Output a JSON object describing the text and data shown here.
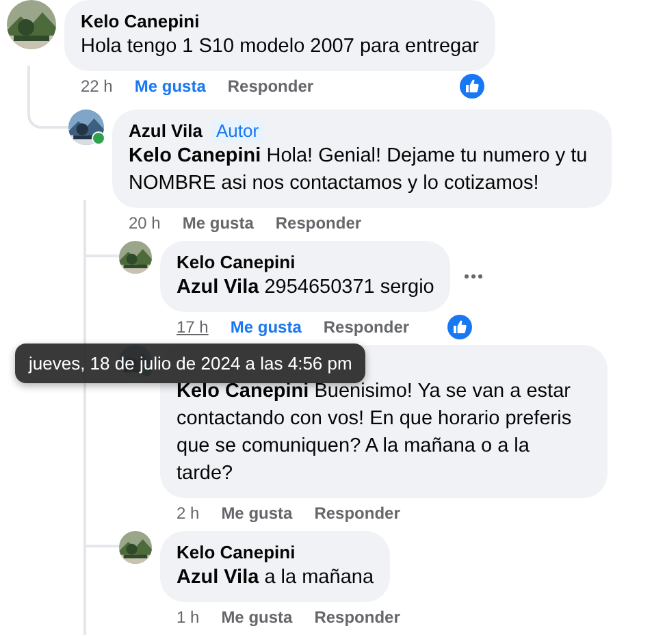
{
  "comments": [
    {
      "author": "Kelo Canepini",
      "online": false,
      "text": "Hola tengo 1 S10 modelo 2007 para entregar",
      "time": "22 h",
      "time_hovered": false,
      "like_label": "Me gusta",
      "liked": true,
      "reply_label": "Responder",
      "has_reaction": true,
      "more_button": false,
      "children": [
        {
          "author": "Azul Vila",
          "author_badge": "Autor",
          "online": true,
          "text": "**Kelo Canepini** Hola! Genial! Dejame tu numero y tu NOMBRE asi nos contactamos y lo cotizamos!",
          "time": "20 h",
          "time_hovered": false,
          "like_label": "Me gusta",
          "liked": false,
          "reply_label": "Responder",
          "has_reaction": false,
          "more_button": false,
          "children": [
            {
              "author": "Kelo Canepini",
              "online": false,
              "text": "**Azul Vila** 2954650371 sergio",
              "time": "17 h",
              "time_hovered": true,
              "like_label": "Me gusta",
              "liked": true,
              "reply_label": "Responder",
              "has_reaction": true,
              "more_button": true
            },
            {
              "online": true,
              "text": "**Kelo Canepini** Buenisimo! Ya se van a estar contactando con vos! En que horario preferis que se comuniquen? A la mañana o a la tarde?",
              "time": "2 h",
              "time_hovered": false,
              "like_label": "Me gusta",
              "liked": false,
              "reply_label": "Responder",
              "has_reaction": false,
              "more_button": false
            },
            {
              "author": "Kelo Canepini",
              "online": false,
              "text": "**Azul Vila** a la mañana",
              "time": "1 h",
              "time_hovered": false,
              "like_label": "Me gusta",
              "liked": false,
              "reply_label": "Responder",
              "has_reaction": false,
              "more_button": false
            }
          ]
        }
      ]
    }
  ],
  "tooltip": {
    "text": "jueves, 18 de julio de 2024 a las 4:56 pm"
  }
}
